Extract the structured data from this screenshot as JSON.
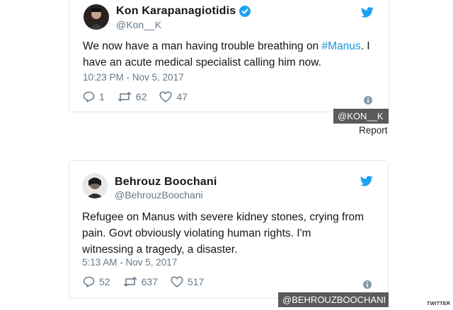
{
  "tweet1": {
    "display_name": "Kon Karapanagiotidis",
    "handle": "@Kon__K",
    "text_before": "We now have a man having trouble breathing on ",
    "hashtag": "#Manus",
    "text_after": ". I have an acute medical specialist calling him now.",
    "timestamp": "10:23 PM - Nov 5, 2017",
    "reply_count": "1",
    "retweet_count": "62",
    "like_count": "47",
    "credit": "@KON__K",
    "report": "Report"
  },
  "tweet2": {
    "display_name": "Behrouz Boochani",
    "handle": "@BehrouzBoochani",
    "text": "Refugee on Manus with severe kidney stones, crying from pain. Govt obviously violating human rights. I'm witnessing a tragedy, a disaster.",
    "timestamp": "5:13 AM - Nov 5, 2017",
    "reply_count": "52",
    "retweet_count": "637",
    "like_count": "517",
    "credit": "@BEHROUZBOOCHANI"
  },
  "source_tag": "TWITTER",
  "colors": {
    "twitter_blue": "#1da1f2",
    "hashtag_blue": "#1b95e0",
    "muted_gray": "#657786",
    "credit_bg": "#5a5a5a"
  },
  "icons": [
    "verified-badge-icon",
    "twitter-bird-icon",
    "reply-icon",
    "retweet-icon",
    "like-icon",
    "info-icon"
  ]
}
